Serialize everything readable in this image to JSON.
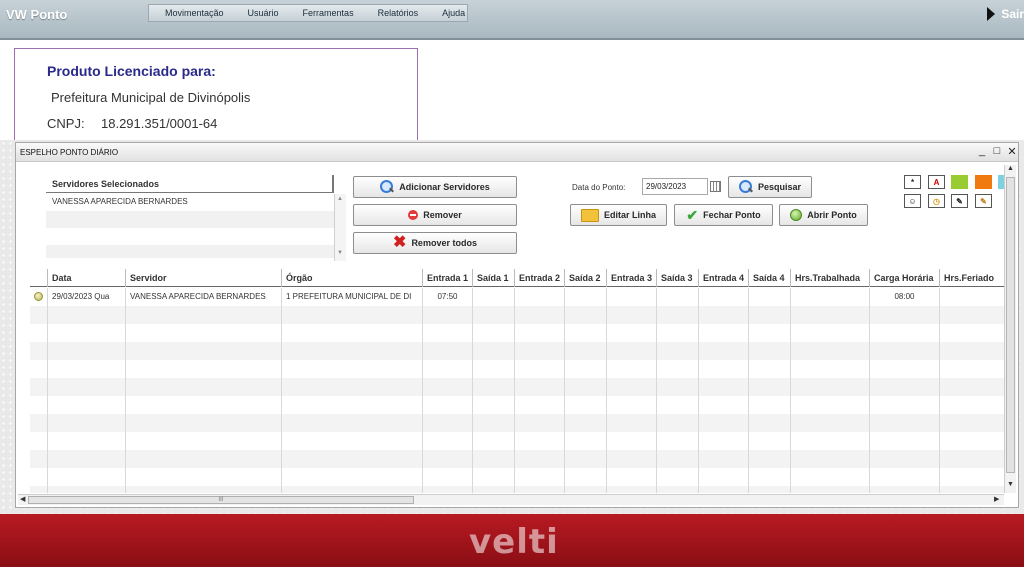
{
  "app": {
    "title": "VW Ponto",
    "logout_label": "Sair"
  },
  "menu": [
    "Movimentação",
    "Usuário",
    "Ferramentas",
    "Relatórios",
    "Ajuda"
  ],
  "license": {
    "title": "Produto Licenciado para:",
    "organization": "Prefeitura Municipal de Divinópolis",
    "cnpj_label": "CNPJ:",
    "cnpj": "18.291.351/0001-64"
  },
  "window": {
    "title": "ESPELHO PONTO DIÁRIO",
    "controls": {
      "minimize": "_",
      "maximize": "□",
      "close": "✕"
    }
  },
  "selected_servers": {
    "header": "Servidores Selecionados",
    "items": [
      "VANESSA APARECIDA BERNARDES"
    ]
  },
  "buttons": {
    "add_servers": "Adicionar Servidores",
    "remove": "Remover",
    "remove_all": "Remover todos",
    "search": "Pesquisar",
    "edit_line": "Editar Linha",
    "close_point": "Fechar Ponto",
    "open_point": "Abrir Ponto"
  },
  "date_filter": {
    "label": "Data do Ponto:",
    "value": "29/03/2023"
  },
  "legend_colors": {
    "green": "#99cc33",
    "orange": "#f07a10",
    "teal": "#7fd0e0"
  },
  "grid": {
    "columns": [
      "Data",
      "Servidor",
      "Órgão",
      "Entrada 1",
      "Saída 1",
      "Entrada 2",
      "Saída 2",
      "Entrada 3",
      "Saída 3",
      "Entrada 4",
      "Saída 4",
      "Hrs.Trabalhada",
      "Carga Horária",
      "Hrs.Feriado"
    ],
    "rows": [
      {
        "data": "29/03/2023 Qua",
        "servidor": "VANESSA APARECIDA BERNARDES",
        "orgao": "1 PREFEITURA MUNICIPAL DE DI",
        "entrada1": "07:50",
        "saida1": "",
        "entrada2": "",
        "saida2": "",
        "entrada3": "",
        "saida3": "",
        "entrada4": "",
        "saida4": "",
        "hrs_trabalhada": "",
        "carga_horaria": "08:00",
        "hrs_feriado": ""
      }
    ]
  },
  "scrollbar": {
    "grip": "III"
  },
  "footer": {
    "brand": "velti"
  }
}
